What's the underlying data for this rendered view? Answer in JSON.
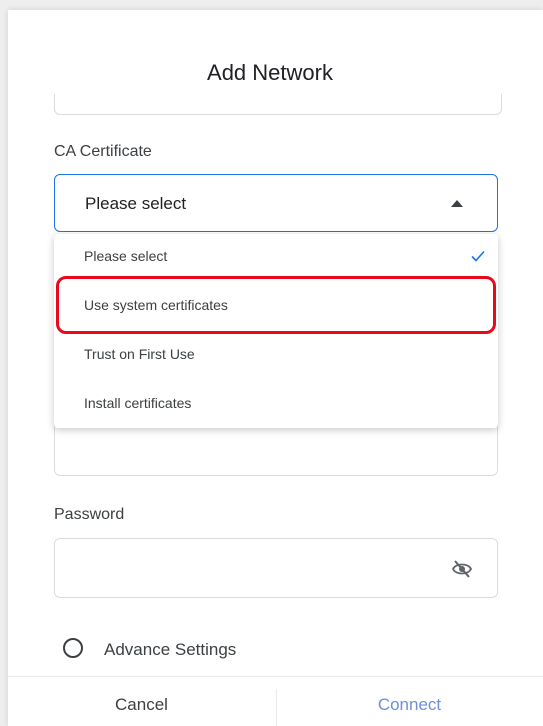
{
  "dialog": {
    "title": "Add Network"
  },
  "ca_certificate": {
    "label": "CA Certificate",
    "selected_value": "Please select",
    "options": [
      {
        "label": "Please select",
        "selected": true
      },
      {
        "label": "Use system certificates",
        "selected": false
      },
      {
        "label": "Trust on First Use",
        "selected": false
      },
      {
        "label": "Install certificates",
        "selected": false
      }
    ]
  },
  "password": {
    "label": "Password",
    "value": "",
    "visibility_icon": "eye-off-icon"
  },
  "advance_settings": {
    "label": "Advance Settings",
    "checked": false
  },
  "footer": {
    "cancel_label": "Cancel",
    "connect_label": "Connect"
  },
  "colors": {
    "accent": "#1a73e8",
    "highlight": "#e8091d",
    "connect": "#6f8fd9"
  }
}
